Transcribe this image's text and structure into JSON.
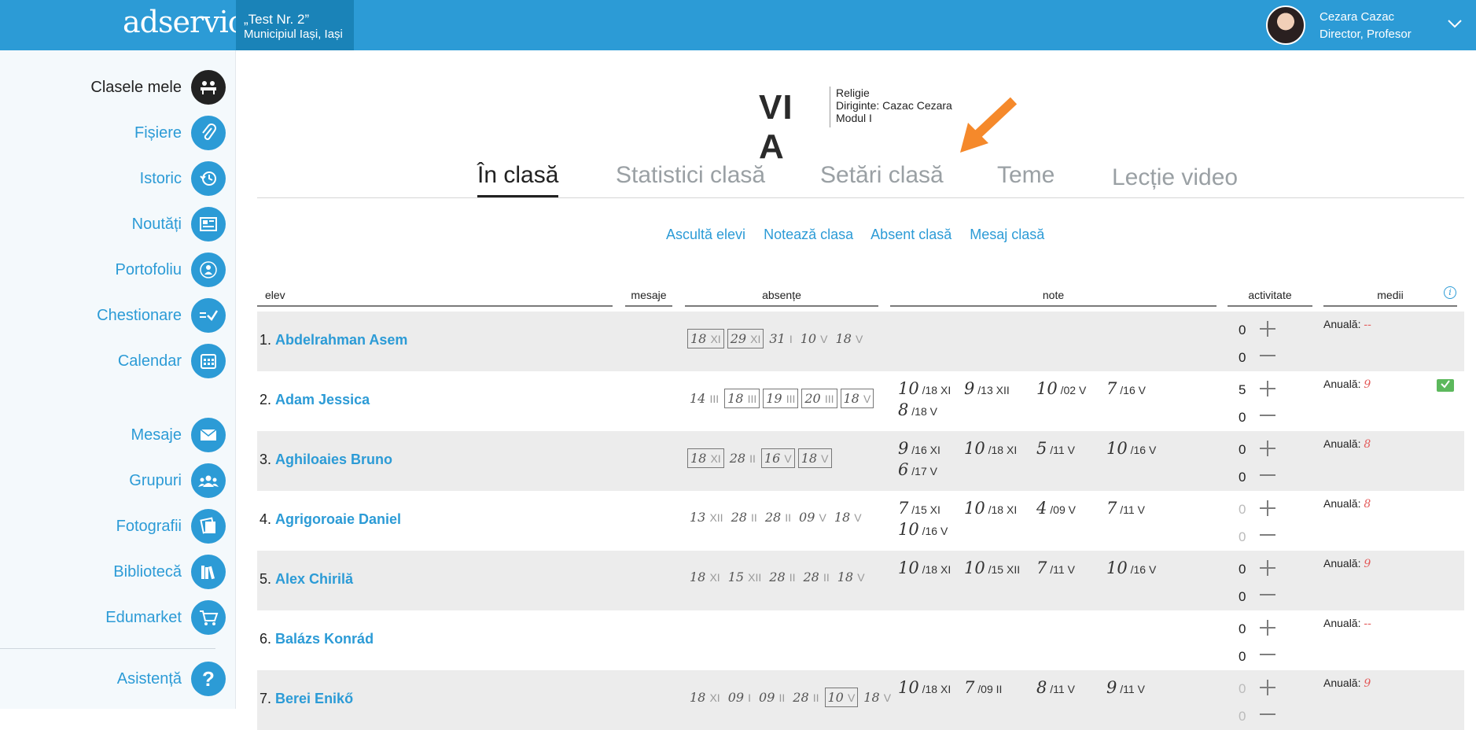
{
  "topbar": {
    "logo": "adservio",
    "school_line1": "„Test Nr. 2”",
    "school_line2": "Municipiul Iași, Iași",
    "user_name": "Cezara Cazac",
    "user_role": "Director, Profesor",
    "accent": "#2c9bd6"
  },
  "sidebar": {
    "items": [
      {
        "label": "Clasele mele",
        "icon": "classroom-icon"
      },
      {
        "label": "Fișiere",
        "icon": "paperclip-icon"
      },
      {
        "label": "Istoric",
        "icon": "history-icon"
      },
      {
        "label": "Noutăți",
        "icon": "news-icon"
      },
      {
        "label": "Portofoliu",
        "icon": "portfolio-icon"
      },
      {
        "label": "Chestionare",
        "icon": "questionnaire-icon"
      },
      {
        "label": "Calendar",
        "icon": "calendar-icon"
      },
      {
        "label": "Mesaje",
        "icon": "envelope-icon"
      },
      {
        "label": "Grupuri",
        "icon": "groups-icon"
      },
      {
        "label": "Fotografii",
        "icon": "photos-icon"
      },
      {
        "label": "Bibliotecă",
        "icon": "library-icon"
      },
      {
        "label": "Edumarket",
        "icon": "cart-icon"
      },
      {
        "label": "Asistență",
        "icon": "help-icon"
      }
    ]
  },
  "class": {
    "name": "VI A",
    "subject": "Religie",
    "diriginte": "Diriginte: Cazac Cezara",
    "module": "Modul I"
  },
  "tabs": [
    "În clasă",
    "Statistici clasă",
    "Setări clasă",
    "Teme",
    "Lecție video"
  ],
  "actions": [
    "Ascultă elevi",
    "Notează clasa",
    "Absent clasă",
    "Mesaj clasă"
  ],
  "columns": {
    "elev": "elev",
    "mesaje": "mesaje",
    "absente": "absențe",
    "note": "note",
    "activitate": "activitate",
    "medii": "medii"
  },
  "avg_label": "Anuală:",
  "students": [
    {
      "num": "1.",
      "name": "Abdelrahman Asem",
      "absences": [
        [
          "18",
          "XI",
          true
        ],
        [
          "29",
          "XI",
          true
        ],
        [
          "31",
          "I",
          false
        ],
        [
          "10",
          "V",
          false
        ],
        [
          "18",
          "V",
          false
        ]
      ],
      "grades": [],
      "act_plus": "0",
      "act_minus": "0",
      "dim": false,
      "avg": "--",
      "check": false
    },
    {
      "num": "2.",
      "name": "Adam Jessica",
      "absences": [
        [
          "14",
          "III",
          false
        ],
        [
          "18",
          "III",
          true
        ],
        [
          "19",
          "III",
          true
        ],
        [
          "20",
          "III",
          true
        ],
        [
          "18",
          "V",
          true
        ]
      ],
      "grades": [
        [
          "10",
          "18 XI"
        ],
        [
          "9",
          "13 XII"
        ],
        [
          "10",
          "02 V"
        ],
        [
          "7",
          "16 V"
        ],
        [
          "8",
          "18 V"
        ]
      ],
      "act_plus": "5",
      "act_minus": "0",
      "dim": false,
      "avg": "9",
      "check": true
    },
    {
      "num": "3.",
      "name": "Aghiloaies Bruno",
      "absences": [
        [
          "18",
          "XI",
          true
        ],
        [
          "28",
          "II",
          false
        ],
        [
          "16",
          "V",
          true
        ],
        [
          "18",
          "V",
          true
        ]
      ],
      "grades": [
        [
          "9",
          "16 XI"
        ],
        [
          "10",
          "18 XI"
        ],
        [
          "5",
          "11 V"
        ],
        [
          "10",
          "16 V"
        ],
        [
          "6",
          "17 V"
        ]
      ],
      "act_plus": "0",
      "act_minus": "0",
      "dim": false,
      "avg": "8",
      "check": false
    },
    {
      "num": "4.",
      "name": "Agrigoroaie Daniel",
      "absences": [
        [
          "13",
          "XII",
          false
        ],
        [
          "28",
          "II",
          false
        ],
        [
          "28",
          "II",
          false
        ],
        [
          "09",
          "V",
          false
        ],
        [
          "18",
          "V",
          false
        ]
      ],
      "grades": [
        [
          "7",
          "15 XI"
        ],
        [
          "10",
          "18 XI"
        ],
        [
          "4",
          "09 V"
        ],
        [
          "7",
          "11 V"
        ],
        [
          "10",
          "16 V"
        ]
      ],
      "act_plus": "0",
      "act_minus": "0",
      "dim": true,
      "avg": "8",
      "check": false
    },
    {
      "num": "5.",
      "name": "Alex Chirilă",
      "absences": [
        [
          "18",
          "XI",
          false
        ],
        [
          "15",
          "XII",
          false
        ],
        [
          "28",
          "II",
          false
        ],
        [
          "28",
          "II",
          false
        ],
        [
          "18",
          "V",
          false
        ]
      ],
      "grades": [
        [
          "10",
          "18 XI"
        ],
        [
          "10",
          "15 XII"
        ],
        [
          "7",
          "11 V"
        ],
        [
          "10",
          "16 V"
        ]
      ],
      "act_plus": "0",
      "act_minus": "0",
      "dim": false,
      "avg": "9",
      "check": false
    },
    {
      "num": "6.",
      "name": "Balázs Konrád",
      "absences": [],
      "grades": [],
      "act_plus": "0",
      "act_minus": "0",
      "dim": false,
      "avg": "--",
      "check": false
    },
    {
      "num": "7.",
      "name": "Berei Enikő",
      "absences": [
        [
          "18",
          "XI",
          false
        ],
        [
          "09",
          "I",
          false
        ],
        [
          "09",
          "II",
          false
        ],
        [
          "28",
          "II",
          false
        ],
        [
          "10",
          "V",
          true
        ],
        [
          "18",
          "V",
          false
        ]
      ],
      "grades": [
        [
          "10",
          "18 XI"
        ],
        [
          "7",
          "09 II"
        ],
        [
          "8",
          "11 V"
        ],
        [
          "9",
          "11 V"
        ]
      ],
      "act_plus": "0",
      "act_minus": "0",
      "dim": true,
      "avg": "9",
      "check": false
    }
  ]
}
